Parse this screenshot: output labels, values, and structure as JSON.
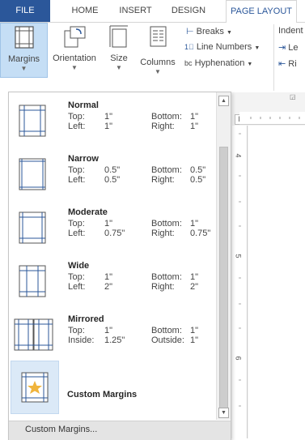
{
  "tabs": [
    "FILE",
    "HOME",
    "INSERT",
    "DESIGN",
    "PAGE LAYOUT"
  ],
  "ribbon": {
    "margins": "Margins",
    "orientation": "Orientation",
    "size": "Size",
    "columns": "Columns",
    "breaks": "Breaks",
    "line_numbers": "Line Numbers",
    "hyphenation": "Hyphenation",
    "indent": "Indent",
    "indent_left": "Le",
    "indent_right": "Ri"
  },
  "ruler": {
    "corner": "L",
    "v4": "4",
    "v5": "5",
    "v6": "6"
  },
  "margins_menu": {
    "items": [
      {
        "name": "Normal",
        "a_key": "Top:",
        "a_val": "1\"",
        "b_key": "Bottom:",
        "b_val": "1\"",
        "c_key": "Left:",
        "c_val": "1\"",
        "d_key": "Right:",
        "d_val": "1\""
      },
      {
        "name": "Narrow",
        "a_key": "Top:",
        "a_val": "0.5\"",
        "b_key": "Bottom:",
        "b_val": "0.5\"",
        "c_key": "Left:",
        "c_val": "0.5\"",
        "d_key": "Right:",
        "d_val": "0.5\""
      },
      {
        "name": "Moderate",
        "a_key": "Top:",
        "a_val": "1\"",
        "b_key": "Bottom:",
        "b_val": "1\"",
        "c_key": "Left:",
        "c_val": "0.75\"",
        "d_key": "Right:",
        "d_val": "0.75\""
      },
      {
        "name": "Wide",
        "a_key": "Top:",
        "a_val": "1\"",
        "b_key": "Bottom:",
        "b_val": "1\"",
        "c_key": "Left:",
        "c_val": "2\"",
        "d_key": "Right:",
        "d_val": "2\""
      },
      {
        "name": "Mirrored",
        "a_key": "Top:",
        "a_val": "1\"",
        "b_key": "Bottom:",
        "b_val": "1\"",
        "c_key": "Inside:",
        "c_val": "1.25\"",
        "d_key": "Outside:",
        "d_val": "1\""
      }
    ],
    "custom_item": "Custom Margins",
    "footer": "Custom Margins..."
  },
  "colors": {
    "file_tab": "#2b579a",
    "accent": "#2b579a",
    "selected": "#c5def5",
    "star": "#f0b43c"
  }
}
